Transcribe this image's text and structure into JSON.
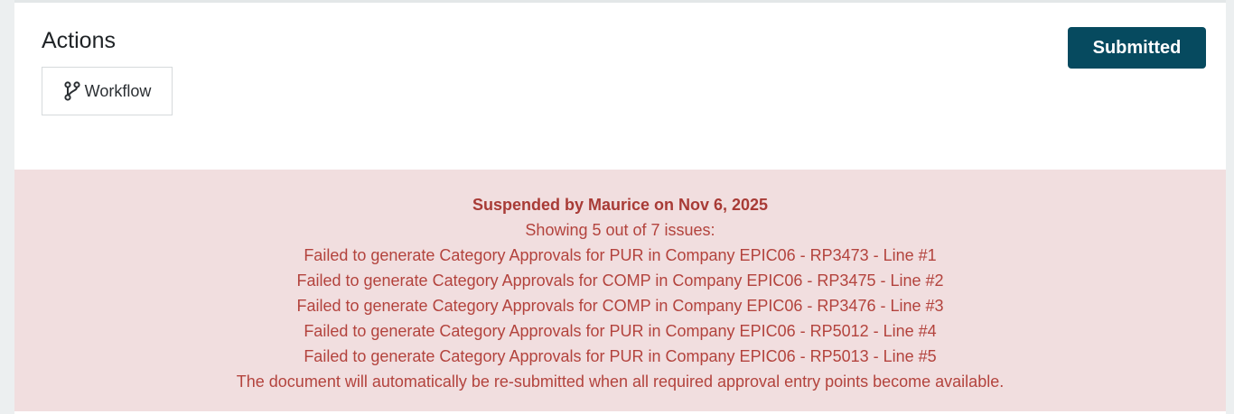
{
  "actions": {
    "heading": "Actions",
    "workflow_label": "Workflow",
    "workflow_icon": "git-branch-icon"
  },
  "status": {
    "label": "Submitted",
    "color": "#064a5f"
  },
  "alert": {
    "title": "Suspended by Maurice on Nov 6, 2025",
    "summary": "Showing 5 out of 7 issues:",
    "issues": [
      "Failed to generate Category Approvals for PUR in Company EPIC06 - RP3473 - Line #1",
      "Failed to generate Category Approvals for COMP in Company EPIC06 - RP3475 - Line #2",
      "Failed to generate Category Approvals for COMP in Company EPIC06 - RP3476 - Line #3",
      "Failed to generate Category Approvals for PUR in Company EPIC06 - RP5012 - Line #4",
      "Failed to generate Category Approvals for PUR in Company EPIC06 - RP5013 - Line #5"
    ],
    "footer": "The document will automatically be re-submitted when all required approval entry points become available.",
    "background": "#f1dedf",
    "text_color": "#b3433d"
  }
}
